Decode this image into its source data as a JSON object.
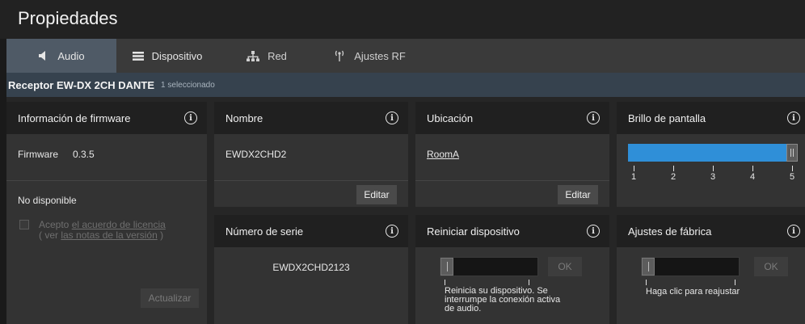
{
  "window": {
    "title": "Propiedades"
  },
  "tabs": [
    {
      "label": "Audio",
      "icon": "speaker-icon",
      "active": true
    },
    {
      "label": "Dispositivo",
      "icon": "list-icon",
      "active": false
    },
    {
      "label": "Red",
      "icon": "network-icon",
      "active": false
    },
    {
      "label": "Ajustes RF",
      "icon": "antenna-icon",
      "active": false
    }
  ],
  "device": {
    "name": "Receptor EW-DX 2CH DANTE",
    "selected": "1 seleccionado"
  },
  "firmware": {
    "header": "Información de firmware",
    "label": "Firmware",
    "version": "0.3.5",
    "status": "No disponible",
    "accept_prefix": "Acepto",
    "accept_link": "el acuerdo de licencia",
    "notes_prefix": "( ver",
    "notes_link": "las notas de la versión",
    "notes_suffix": ")",
    "update_button": "Actualizar"
  },
  "nombre": {
    "header": "Nombre",
    "value": "EWDX2CHD2",
    "edit_button": "Editar"
  },
  "ubicacion": {
    "header": "Ubicación",
    "value": "RoomA",
    "edit_button": "Editar"
  },
  "brillo": {
    "header": "Brillo de pantalla",
    "level": 5,
    "min": 1,
    "max": 5,
    "ticks": [
      "1",
      "2",
      "3",
      "4",
      "5"
    ],
    "fill_color": "#2f8fd8"
  },
  "serie": {
    "header": "Número de serie",
    "value": "EWDX2CHD2123"
  },
  "reiniciar": {
    "header": "Reiniciar dispositivo",
    "ok_button": "OK",
    "hint_line1": "Reinicia su dispositivo. Se",
    "hint_line2": "interrumpe la conexión activa",
    "hint_line3": "de audio."
  },
  "fabrica": {
    "header": "Ajustes de fábrica",
    "ok_button": "OK",
    "hint": "Haga clic para reajustar"
  },
  "colors": {
    "accent": "#2f8fd8",
    "active_tab": "#4f5a66",
    "device_bar": "#36424e"
  }
}
